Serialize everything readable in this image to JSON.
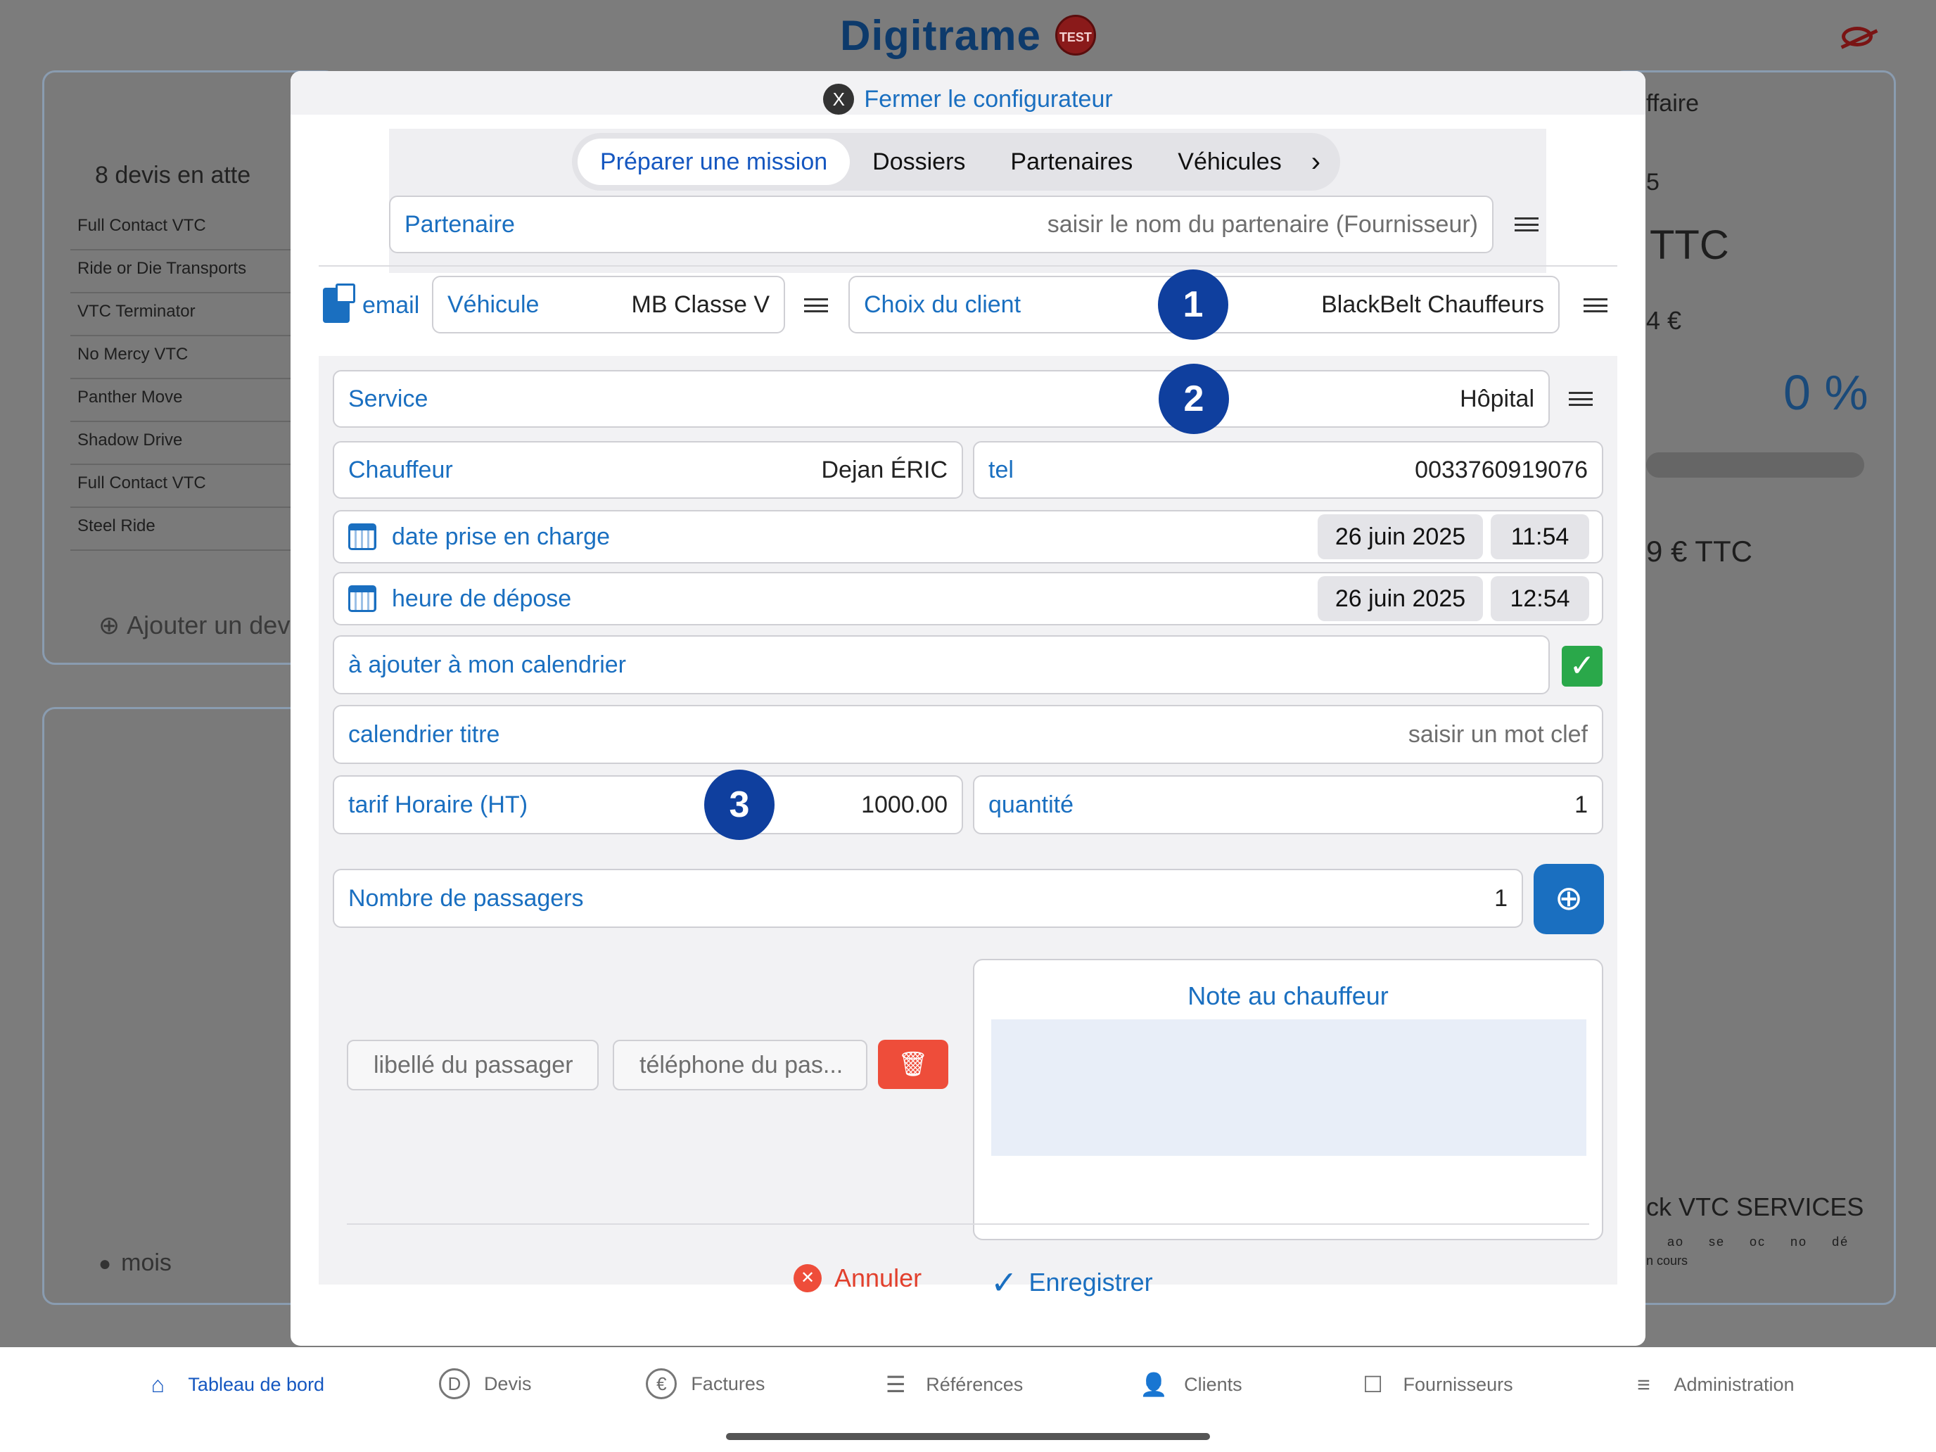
{
  "app": {
    "logo": "Digitrame",
    "logo_badge": "TEST"
  },
  "background": {
    "quotes_title": "8 devis en atte",
    "quotes": [
      "Full Contact VTC",
      "Ride or Die Transports",
      "VTC Terminator",
      "No Mercy VTC",
      "Panther Move",
      "Shadow Drive",
      "Full Contact VTC",
      "Steel Ride"
    ],
    "add_quote": "Ajouter un dev",
    "month": "mois",
    "right_affaire": "ffaire",
    "right_five": "5",
    "right_ttc": "TTC",
    "right_euro": "4 €",
    "right_percent": "0 %",
    "right_ttc2": "9 €  TTC",
    "right_company": "ck VTC SERVICES",
    "right_months": "ao se oc no dé",
    "right_encours": "n cours"
  },
  "modal": {
    "close_label": "Fermer le configurateur",
    "tabs": [
      {
        "label": "Préparer une mission",
        "active": true
      },
      {
        "label": "Dossiers"
      },
      {
        "label": "Partenaires"
      },
      {
        "label": "Véhicules"
      }
    ],
    "partner": {
      "label": "Partenaire",
      "placeholder": "saisir le nom du partenaire (Fournisseur)"
    },
    "email_label": "email",
    "vehicle": {
      "label": "Véhicule",
      "value": "MB Classe V"
    },
    "client": {
      "label": "Choix du client",
      "value": "BlackBelt Chauffeurs"
    },
    "service": {
      "label": "Service",
      "value": "Hôpital"
    },
    "driver": {
      "label": "Chauffeur",
      "value": "Dejan ÉRIC"
    },
    "tel": {
      "label": "tel",
      "value": "0033760919076"
    },
    "pickup": {
      "label": "date prise en charge",
      "date": "26 juin 2025",
      "time": "11:54"
    },
    "dropoff": {
      "label": "heure de dépose",
      "date": "26 juin 2025",
      "time": "12:54"
    },
    "add_calendar": {
      "label": "à ajouter à mon calendrier",
      "checked": true
    },
    "calendar_title": {
      "label": "calendrier titre",
      "placeholder": "saisir un mot clef"
    },
    "rate": {
      "label": "tarif Horaire (HT)",
      "value": "1000.00"
    },
    "quantity": {
      "label": "quantité",
      "value": "1"
    },
    "passengers": {
      "label": "Nombre de passagers",
      "value": "1"
    },
    "passenger_name_placeholder": "libellé du passager",
    "passenger_phone_placeholder": "téléphone du pas...",
    "note_title": "Note au chauffeur",
    "badges": [
      "1",
      "2",
      "3"
    ],
    "cancel_label": "Annuler",
    "save_label": "Enregistrer"
  },
  "tabbar": [
    {
      "label": "Tableau de bord",
      "icon": "home-icon",
      "active": true
    },
    {
      "label": "Devis",
      "icon": "d-circle-icon"
    },
    {
      "label": "Factures",
      "icon": "euro-circle-icon"
    },
    {
      "label": "Références",
      "icon": "list-icon"
    },
    {
      "label": "Clients",
      "icon": "contact-icon"
    },
    {
      "label": "Fournisseurs",
      "icon": "supplier-icon"
    },
    {
      "label": "Administration",
      "icon": "sliders-icon"
    }
  ],
  "colors": {
    "accent": "#1a6fc0",
    "badge": "#0f3f9e",
    "danger": "#ee4d3a",
    "success": "#2aa84a"
  }
}
